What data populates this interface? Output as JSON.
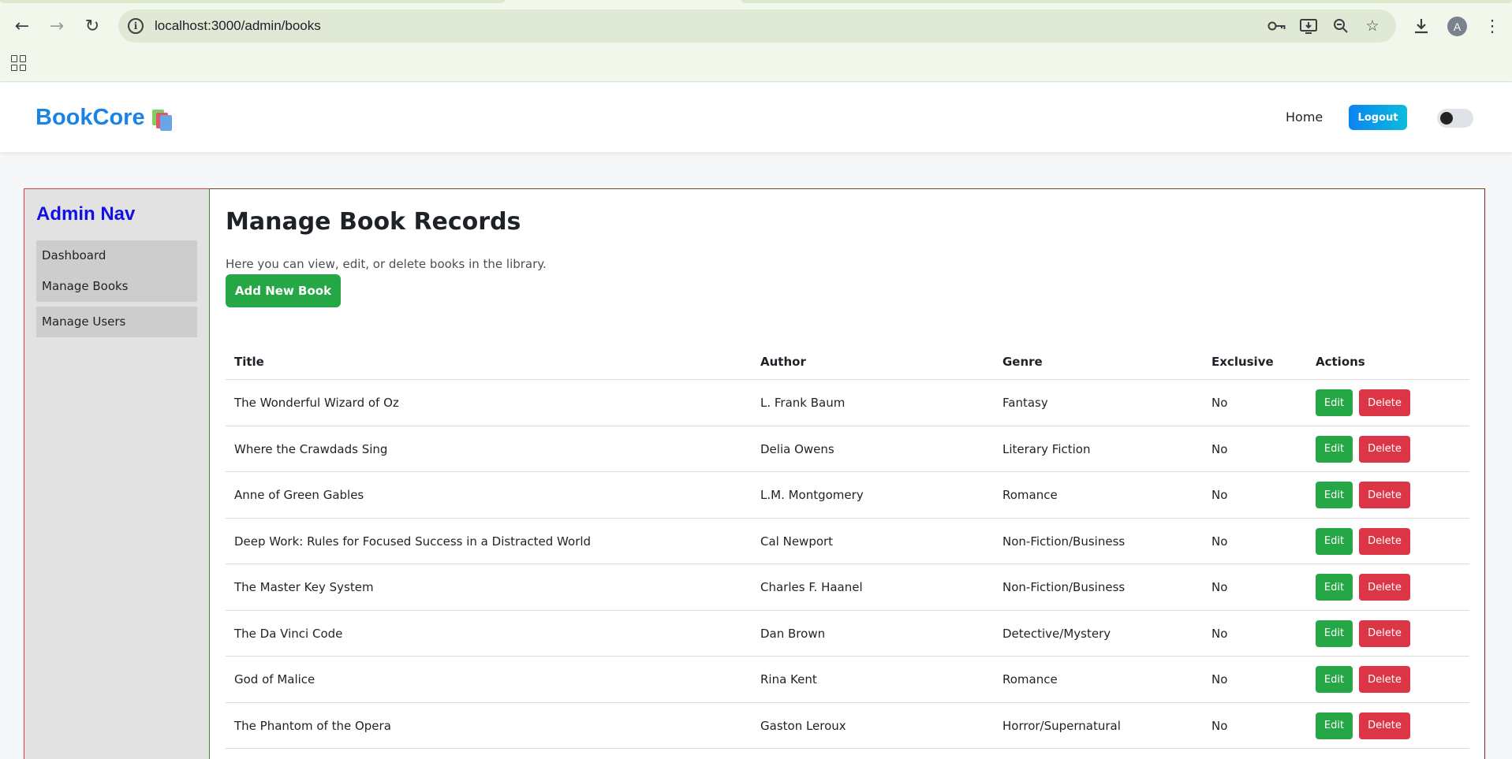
{
  "browser": {
    "url": "localhost:3000/admin/books",
    "avatar_letter": "A",
    "icons": [
      "back-icon",
      "forward-icon",
      "reload-icon",
      "site-info-icon",
      "password-key-icon",
      "install-app-icon",
      "zoom-icon",
      "bookmark-star-icon",
      "download-icon",
      "profile-avatar",
      "menu-kebab-icon",
      "apps-grid-icon"
    ]
  },
  "header": {
    "brand": "BookCore",
    "nav_home": "Home",
    "logout_label": "Logout",
    "theme_toggle_on": false
  },
  "sidebar": {
    "title": "Admin Nav",
    "items": [
      {
        "label": "Dashboard"
      },
      {
        "label": "Manage Books"
      },
      {
        "label": "Manage Users"
      }
    ]
  },
  "main": {
    "title": "Manage Book Records",
    "description": "Here you can view, edit, or delete books in the library.",
    "add_button": "Add New Book",
    "table": {
      "columns": [
        "Title",
        "Author",
        "Genre",
        "Exclusive",
        "Actions"
      ],
      "edit_label": "Edit",
      "delete_label": "Delete",
      "rows": [
        {
          "title": "The Wonderful Wizard of Oz",
          "author": "L. Frank Baum",
          "genre": "Fantasy",
          "exclusive": "No"
        },
        {
          "title": "Where the Crawdads Sing",
          "author": "Delia Owens",
          "genre": "Literary Fiction",
          "exclusive": "No"
        },
        {
          "title": "Anne of Green Gables",
          "author": "L.M. Montgomery",
          "genre": "Romance",
          "exclusive": "No"
        },
        {
          "title": "Deep Work: Rules for Focused Success in a Distracted World",
          "author": "Cal Newport",
          "genre": "Non-Fiction/Business",
          "exclusive": "No"
        },
        {
          "title": "The Master Key System",
          "author": "Charles F. Haanel",
          "genre": "Non-Fiction/Business",
          "exclusive": "No"
        },
        {
          "title": "The Da Vinci Code",
          "author": "Dan Brown",
          "genre": "Detective/Mystery",
          "exclusive": "No"
        },
        {
          "title": "God of Malice",
          "author": "Rina Kent",
          "genre": "Romance",
          "exclusive": "No"
        },
        {
          "title": "The Phantom of the Opera",
          "author": "Gaston Leroux",
          "genre": "Horror/Supernatural",
          "exclusive": "No"
        }
      ]
    }
  },
  "colors": {
    "brand": "#1a83e6",
    "sidebar_title": "#1010e8",
    "success": "#25a745",
    "danger": "#dc3545"
  }
}
